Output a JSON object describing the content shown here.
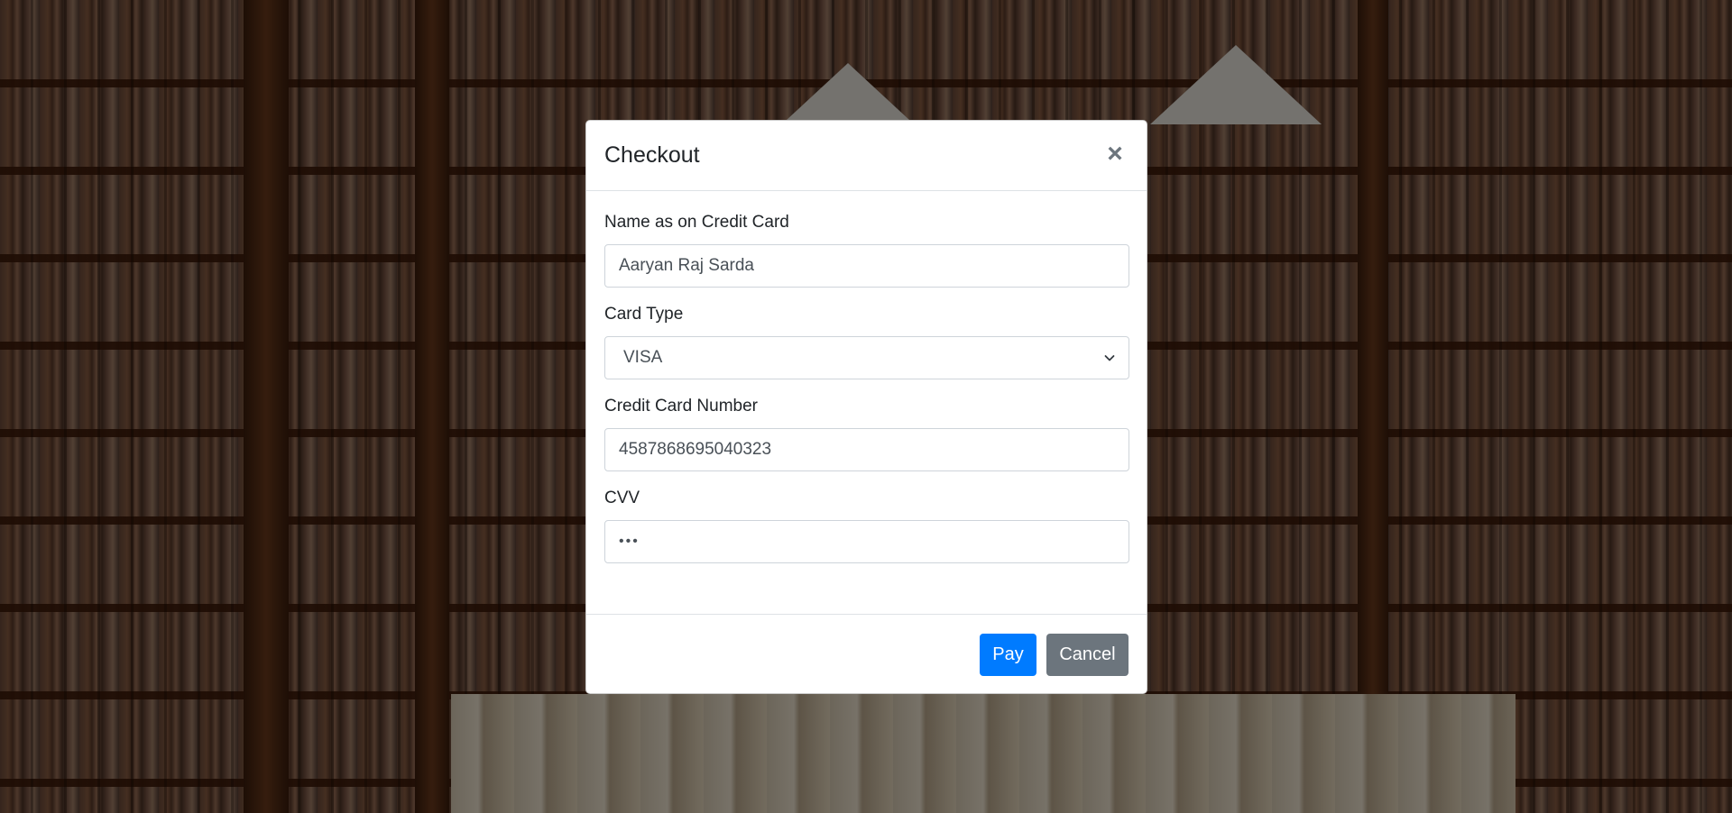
{
  "modal": {
    "title": "Checkout",
    "close_glyph": "×",
    "close_icon": "close-icon"
  },
  "form": {
    "name_label": "Name as on Credit Card",
    "name_value": "Aaryan Raj Sarda",
    "card_type_label": "Card Type",
    "card_type_value": "VISA",
    "card_number_label": "Credit Card Number",
    "card_number_value": "4587868695040323",
    "cvv_label": "CVV",
    "cvv_masked": "•••"
  },
  "footer": {
    "pay_label": "Pay",
    "cancel_label": "Cancel"
  },
  "colors": {
    "primary": "#007bff",
    "secondary": "#6c757d",
    "overlay": "rgba(0,0,0,0.5)"
  }
}
